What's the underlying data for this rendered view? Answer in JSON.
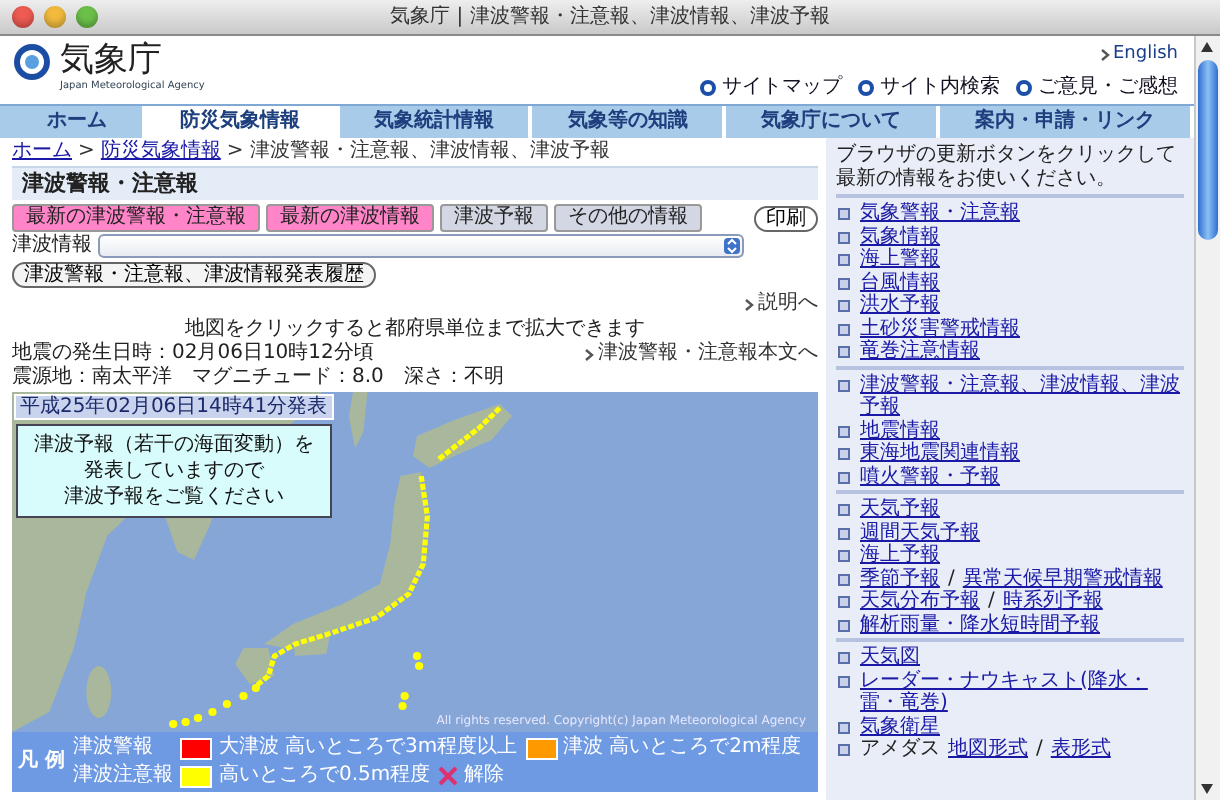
{
  "window": {
    "title": "気象庁 | 津波警報・注意報、津波情報、津波予報"
  },
  "header": {
    "logo_text": "気象庁",
    "logo_subtitle": "Japan Meteorological Agency",
    "english_link": "English",
    "site_links": [
      "サイトマップ",
      "サイト内検索",
      "ご意見・ご感想"
    ]
  },
  "nav": [
    {
      "label": "ホーム",
      "selected": false
    },
    {
      "label": "防災気象情報",
      "selected": true
    },
    {
      "label": "気象統計情報",
      "selected": false
    },
    {
      "label": "気象等の知識",
      "selected": false
    },
    {
      "label": "気象庁について",
      "selected": false
    },
    {
      "label": "案内・申請・リンク",
      "selected": false
    }
  ],
  "breadcrumb": {
    "items": [
      "ホーム",
      "防災気象情報",
      "津波警報・注意報、津波情報、津波予報"
    ],
    "separator": ">"
  },
  "main": {
    "heading": "津波警報・注意報",
    "tab_buttons": [
      {
        "label": "最新の津波警報・注意報",
        "active": true
      },
      {
        "label": "最新の津波情報",
        "active": true
      },
      {
        "label": "津波予報",
        "active": false
      },
      {
        "label": "その他の情報",
        "active": false
      }
    ],
    "print_button": "印刷",
    "select": {
      "label": "津波情報"
    },
    "history_button": "津波警報・注意報、津波情報発表履歴",
    "explanation_link": "説明へ",
    "map_hint": "地図をクリックすると都府県単位まで拡大できます",
    "quake_time": "地震の発生日時：02月06日10時12分頃",
    "quake_info": "震源地：南太平洋　マグニチュード：8.0　深さ：不明",
    "bulletin_link": "津波警報・注意報本文へ",
    "map": {
      "issued": "平成25年02月06日14時41分発表",
      "notice": [
        "津波予報（若干の海面変動）を",
        "発表していますので",
        "津波予報をご覧ください"
      ],
      "copyright": "All rights reserved. Copyright(c) Japan Meteorological Agency"
    },
    "legend": {
      "title": "凡 例",
      "rows": [
        {
          "label": "津波警報",
          "entries": [
            {
              "kind": "swatch",
              "color": "#ff0000",
              "name": "大津波",
              "text": "高いところで3m程度以上"
            },
            {
              "kind": "swatch",
              "color": "#ff9900",
              "name": "津波",
              "text": "高いところで2m程度"
            }
          ]
        },
        {
          "label": "津波注意報",
          "entries": [
            {
              "kind": "swatch",
              "color": "#ffff00",
              "text": "高いところで0.5m程度"
            },
            {
              "kind": "cross",
              "color": "#e03070",
              "text": "解除"
            }
          ]
        }
      ]
    }
  },
  "sidebar": {
    "intro": "ブラウザの更新ボタンをクリックして最新の情報をお使いください。",
    "separator": "/",
    "groups": [
      [
        {
          "links": [
            "気象警報・注意報"
          ]
        },
        {
          "links": [
            "気象情報"
          ]
        },
        {
          "links": [
            "海上警報"
          ]
        },
        {
          "links": [
            "台風情報"
          ]
        },
        {
          "links": [
            "洪水予報"
          ]
        },
        {
          "links": [
            "土砂災害警戒情報"
          ]
        },
        {
          "links": [
            "竜巻注意情報"
          ]
        }
      ],
      [
        {
          "links": [
            "津波警報・注意報、津波情報、津波予報"
          ]
        },
        {
          "links": [
            "地震情報"
          ]
        },
        {
          "links": [
            "東海地震関連情報"
          ]
        },
        {
          "links": [
            "噴火警報・予報"
          ]
        }
      ],
      [
        {
          "links": [
            "天気予報"
          ]
        },
        {
          "links": [
            "週間天気予報"
          ]
        },
        {
          "links": [
            "海上予報"
          ]
        },
        {
          "links": [
            "季節予報",
            "異常天候早期警戒情報"
          ]
        },
        {
          "links": [
            "天気分布予報",
            "時系列予報"
          ]
        },
        {
          "links": [
            "解析雨量・降水短時間予報"
          ]
        }
      ],
      [
        {
          "links": [
            "天気図"
          ]
        },
        {
          "links": [
            "レーダー・ナウキャスト(降水・雷・竜巻)"
          ]
        },
        {
          "links": [
            "気象衛星"
          ]
        },
        {
          "text": "アメダス",
          "links": [
            "地図形式",
            "表形式"
          ]
        }
      ]
    ]
  }
}
